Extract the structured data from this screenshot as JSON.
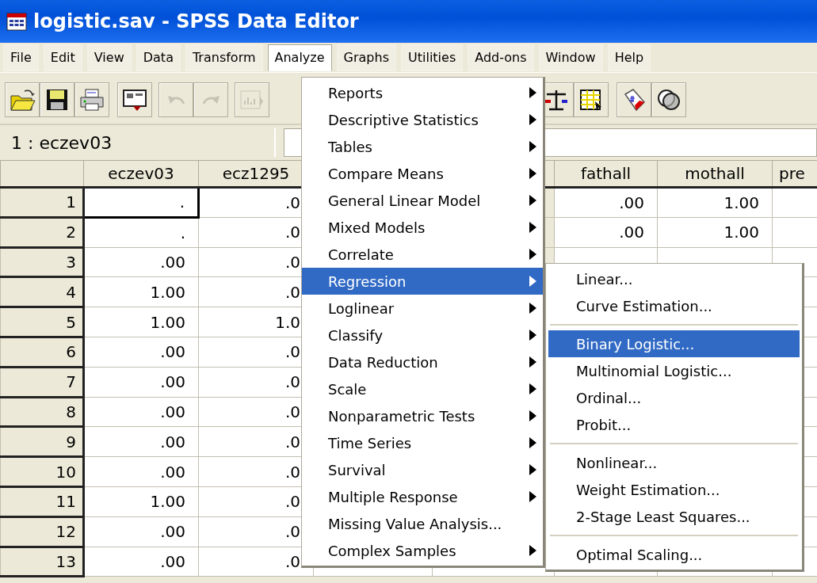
{
  "window": {
    "title": "logistic.sav - SPSS Data Editor"
  },
  "menu_bar": [
    {
      "label": "File",
      "selected": false
    },
    {
      "label": "Edit",
      "selected": false
    },
    {
      "label": "View",
      "selected": false
    },
    {
      "label": "Data",
      "selected": false
    },
    {
      "label": "Transform",
      "selected": false
    },
    {
      "label": "Analyze",
      "selected": true
    },
    {
      "label": "Graphs",
      "selected": false
    },
    {
      "label": "Utilities",
      "selected": false
    },
    {
      "label": "Add-ons",
      "selected": false
    },
    {
      "label": "Window",
      "selected": false
    },
    {
      "label": "Help",
      "selected": false
    }
  ],
  "toolbar": [
    {
      "kind": "open",
      "disabled": false
    },
    {
      "kind": "save",
      "disabled": false
    },
    {
      "kind": "print",
      "disabled": false
    },
    {
      "kind": "dialog",
      "disabled": false
    },
    {
      "kind": "undo",
      "disabled": true
    },
    {
      "kind": "redo",
      "disabled": true
    },
    {
      "kind": "chart",
      "disabled": true
    },
    {
      "kind": "scale",
      "disabled": false
    },
    {
      "kind": "table",
      "disabled": false
    },
    {
      "kind": "tag",
      "disabled": false
    },
    {
      "kind": "circles",
      "disabled": false
    }
  ],
  "cell_reference": "1 : eczev03",
  "grid": {
    "columns": [
      "eczev03",
      "ecz1295",
      null,
      null,
      "fathall",
      "mothall",
      "pre"
    ],
    "rows": [
      {
        "label": "1",
        "selected": true,
        "cells": [
          ".",
          ".0",
          null,
          null,
          ".00",
          "1.00",
          null
        ]
      },
      {
        "label": "2",
        "selected": false,
        "cells": [
          ".",
          ".0",
          null,
          null,
          ".00",
          "1.00",
          null
        ]
      },
      {
        "label": "3",
        "selected": false,
        "cells": [
          ".00",
          ".0",
          null,
          null,
          null,
          null,
          null
        ]
      },
      {
        "label": "4",
        "selected": false,
        "cells": [
          "1.00",
          ".0",
          null,
          null,
          null,
          null,
          null
        ]
      },
      {
        "label": "5",
        "selected": false,
        "cells": [
          "1.00",
          "1.0",
          null,
          null,
          null,
          null,
          null
        ]
      },
      {
        "label": "6",
        "selected": false,
        "cells": [
          ".00",
          ".0",
          null,
          null,
          null,
          null,
          null
        ]
      },
      {
        "label": "7",
        "selected": false,
        "cells": [
          ".00",
          ".0",
          null,
          null,
          null,
          null,
          null
        ]
      },
      {
        "label": "8",
        "selected": false,
        "cells": [
          ".00",
          ".0",
          null,
          null,
          null,
          null,
          null
        ]
      },
      {
        "label": "9",
        "selected": false,
        "cells": [
          ".00",
          ".0",
          null,
          null,
          null,
          null,
          null
        ]
      },
      {
        "label": "10",
        "selected": false,
        "cells": [
          ".00",
          ".0",
          null,
          null,
          null,
          null,
          null
        ]
      },
      {
        "label": "11",
        "selected": false,
        "cells": [
          "1.00",
          ".0",
          null,
          null,
          null,
          null,
          null
        ]
      },
      {
        "label": "12",
        "selected": false,
        "cells": [
          ".00",
          ".0",
          null,
          null,
          null,
          null,
          null
        ]
      },
      {
        "label": "13",
        "selected": false,
        "cells": [
          ".00",
          ".0",
          null,
          null,
          null,
          null,
          null
        ]
      }
    ]
  },
  "analyze_menu": [
    {
      "label": "Reports",
      "submenu": true,
      "selected": false
    },
    {
      "label": "Descriptive Statistics",
      "submenu": true,
      "selected": false
    },
    {
      "label": "Tables",
      "submenu": true,
      "selected": false
    },
    {
      "label": "Compare Means",
      "submenu": true,
      "selected": false
    },
    {
      "label": "General Linear Model",
      "submenu": true,
      "selected": false
    },
    {
      "label": "Mixed Models",
      "submenu": true,
      "selected": false
    },
    {
      "label": "Correlate",
      "submenu": true,
      "selected": false
    },
    {
      "label": "Regression",
      "submenu": true,
      "selected": true
    },
    {
      "label": "Loglinear",
      "submenu": true,
      "selected": false
    },
    {
      "label": "Classify",
      "submenu": true,
      "selected": false
    },
    {
      "label": "Data Reduction",
      "submenu": true,
      "selected": false
    },
    {
      "label": "Scale",
      "submenu": true,
      "selected": false
    },
    {
      "label": "Nonparametric Tests",
      "submenu": true,
      "selected": false
    },
    {
      "label": "Time Series",
      "submenu": true,
      "selected": false
    },
    {
      "label": "Survival",
      "submenu": true,
      "selected": false
    },
    {
      "label": "Multiple Response",
      "submenu": true,
      "selected": false
    },
    {
      "label": "Missing Value Analysis...",
      "submenu": false,
      "selected": false
    },
    {
      "label": "Complex Samples",
      "submenu": true,
      "selected": false
    }
  ],
  "regression_submenu": [
    {
      "kind": "item",
      "label": "Linear...",
      "selected": false
    },
    {
      "kind": "item",
      "label": "Curve Estimation...",
      "selected": false
    },
    {
      "kind": "separator"
    },
    {
      "kind": "item",
      "label": "Binary Logistic...",
      "selected": true
    },
    {
      "kind": "item",
      "label": "Multinomial Logistic...",
      "selected": false
    },
    {
      "kind": "item",
      "label": "Ordinal...",
      "selected": false
    },
    {
      "kind": "item",
      "label": "Probit...",
      "selected": false
    },
    {
      "kind": "separator"
    },
    {
      "kind": "item",
      "label": "Nonlinear...",
      "selected": false
    },
    {
      "kind": "item",
      "label": "Weight Estimation...",
      "selected": false
    },
    {
      "kind": "item",
      "label": "2-Stage Least Squares...",
      "selected": false
    },
    {
      "kind": "separator"
    },
    {
      "kind": "item",
      "label": "Optimal Scaling...",
      "selected": false
    }
  ]
}
